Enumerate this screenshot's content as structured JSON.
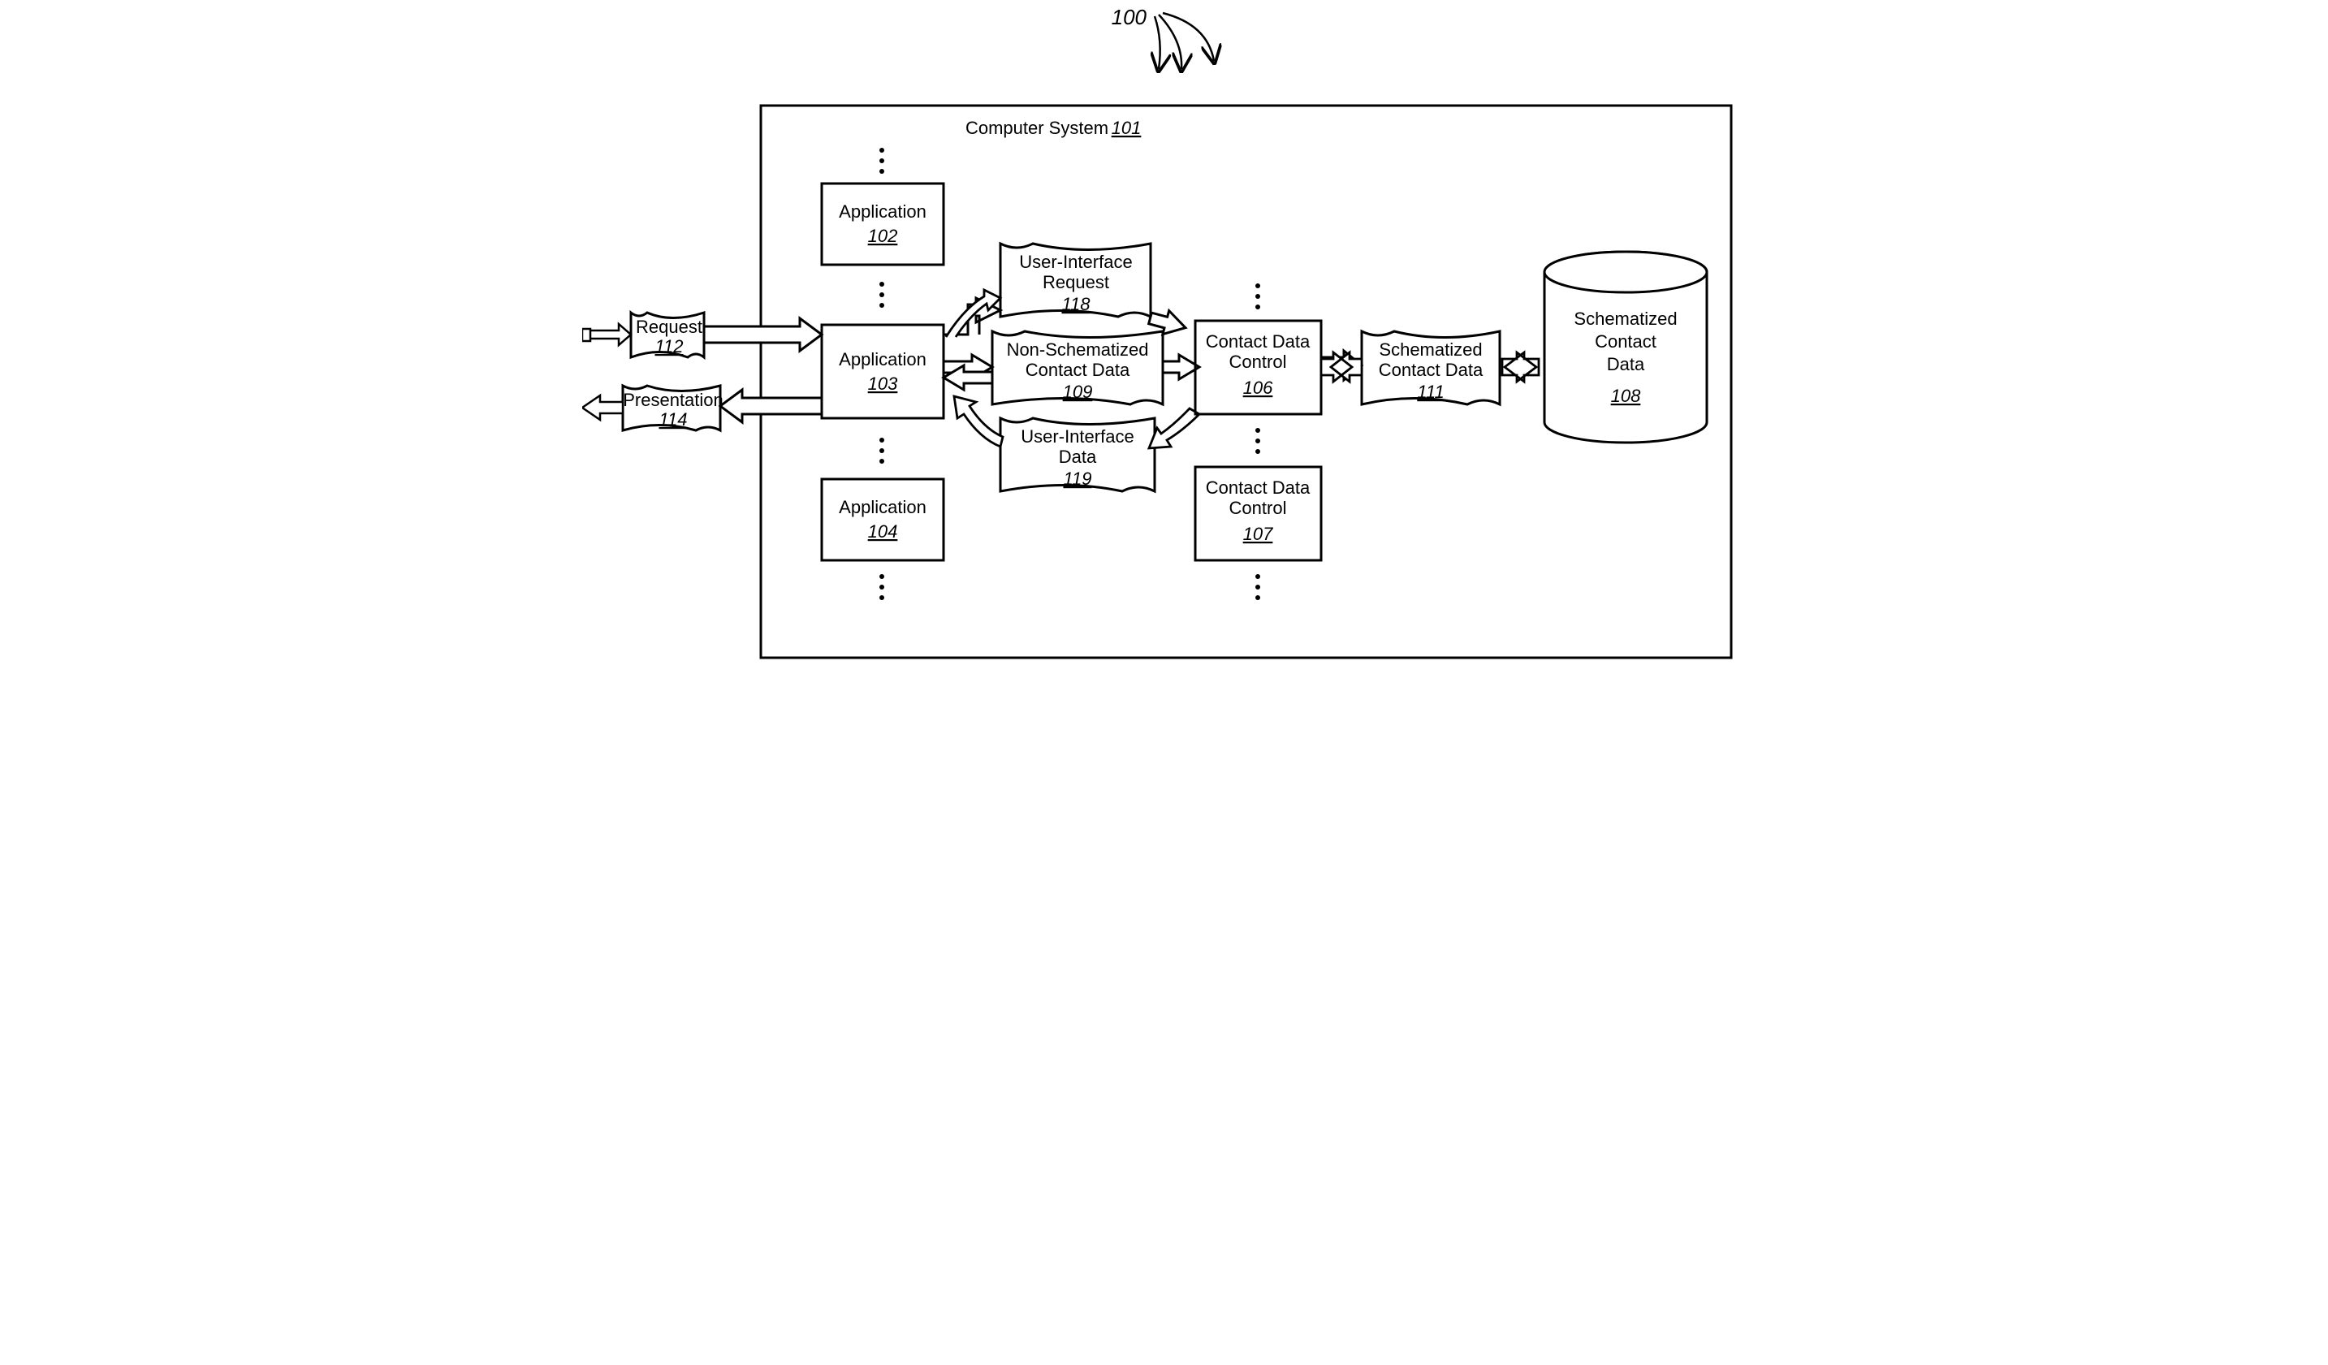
{
  "figure_number": "100",
  "system": {
    "label": "Computer System",
    "num": "101"
  },
  "apps": [
    {
      "label": "Application",
      "num": "102"
    },
    {
      "label": "Application",
      "num": "103"
    },
    {
      "label": "Application",
      "num": "104"
    }
  ],
  "controls": [
    {
      "label": "Contact Data Control",
      "num": "106"
    },
    {
      "label": "Contact Data Control",
      "num": "107"
    }
  ],
  "scrolls": {
    "ui_request": {
      "line1": "User-Interface",
      "line2": "Request",
      "num": "118"
    },
    "non_schema": {
      "line1": "Non-Schematized",
      "line2": "Contact Data",
      "num": "109"
    },
    "ui_data": {
      "line1": "User-Interface",
      "line2": "Data",
      "num": "119"
    },
    "schema": {
      "line1": "Schematized",
      "line2": "Contact Data",
      "num": "111"
    }
  },
  "io": {
    "request": {
      "label": "Request",
      "num": "112"
    },
    "presentation": {
      "label": "Presentation",
      "num": "114"
    }
  },
  "db": {
    "line1": "Schematized",
    "line2": "Contact",
    "line3": "Data",
    "num": "108"
  }
}
